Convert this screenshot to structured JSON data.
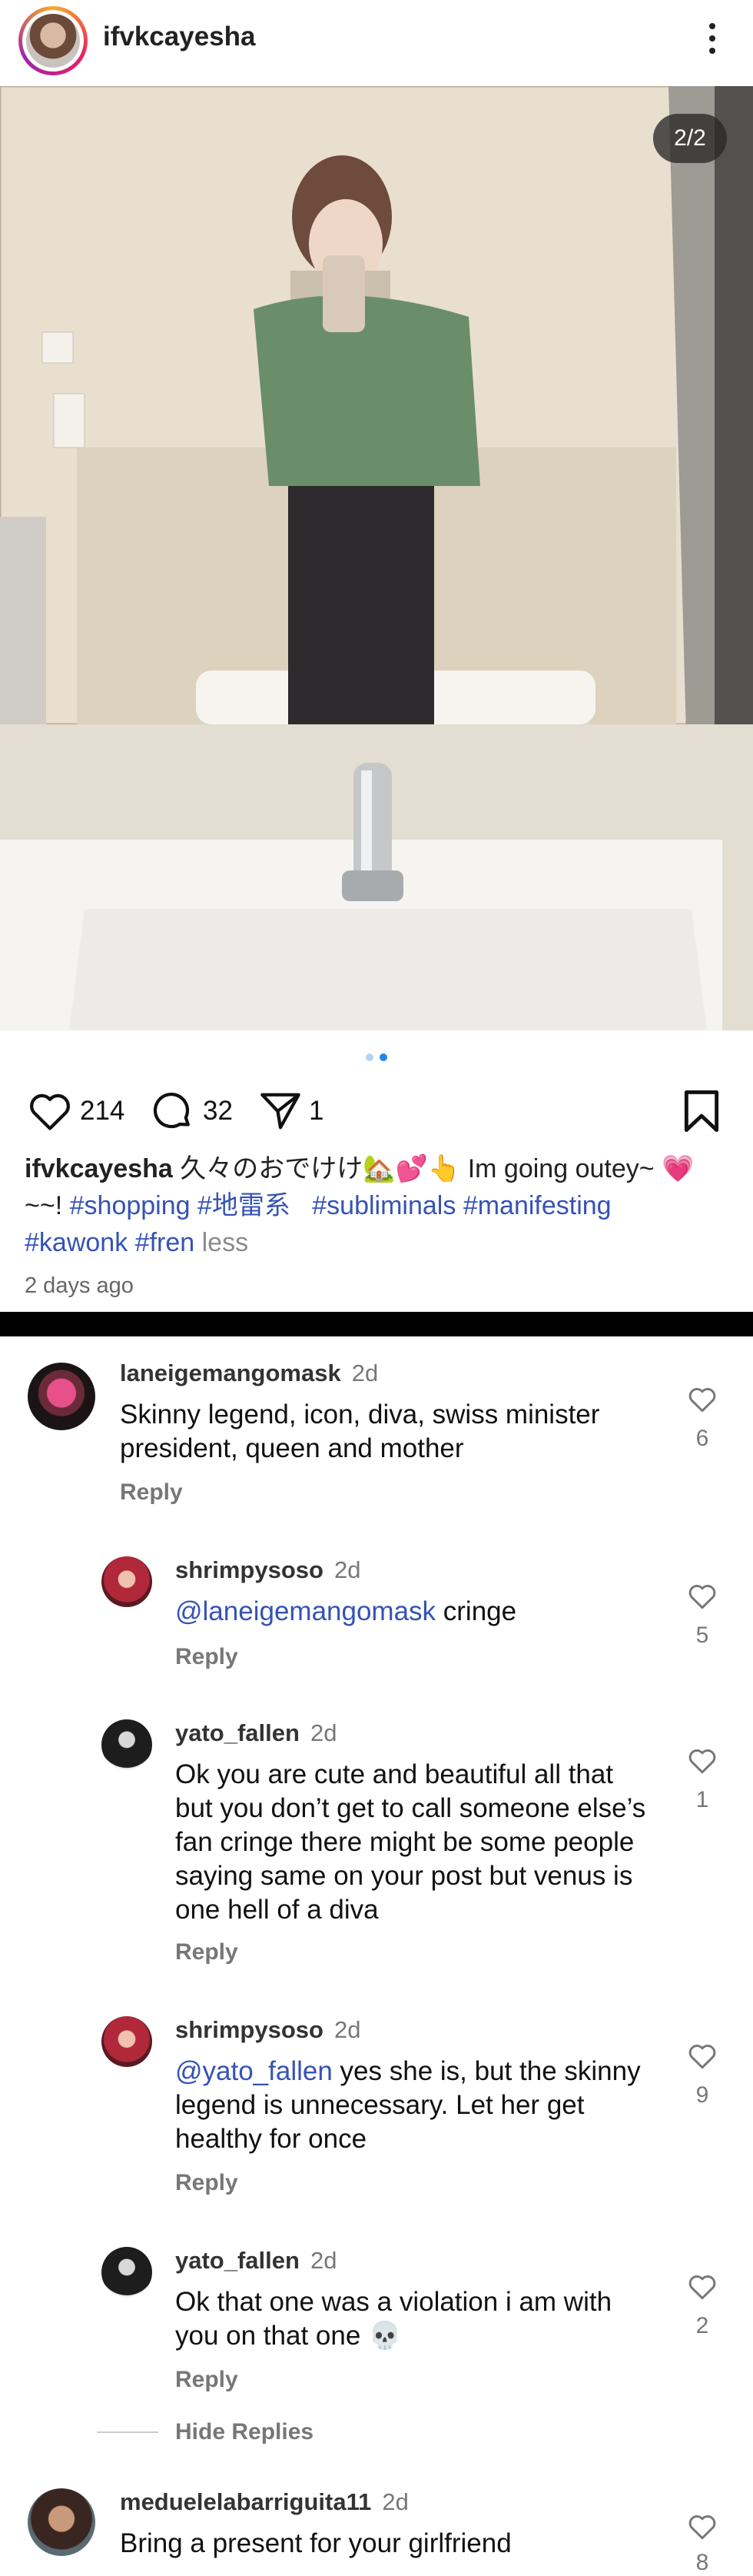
{
  "header": {
    "username": "ifvkcayesha",
    "more_icon": "kebab-menu-icon"
  },
  "post": {
    "image_counter": "2/2",
    "carousel_total": 2,
    "carousel_active": 2,
    "likes": "214",
    "comments": "32",
    "shares": "1",
    "caption_user": "ifvkcayesha",
    "caption_text": "久々のおでけけ🏡💕👆    Im going outey~ 💗~~!",
    "hashtags": [
      "#shopping",
      "#地雷系",
      "#subliminals",
      "#manifesting",
      "#kawonk",
      "#fren"
    ],
    "less_label": "less",
    "time_ago": "2 days ago"
  },
  "colors": {
    "link_blue": "#3553b5",
    "muted_gray": "#777777",
    "divider": "#000000",
    "dot_active": "#1e88e5",
    "dot_inactive": "#b3d4f0"
  },
  "comments": [
    {
      "user": "laneigemangomask",
      "time": "2d",
      "mention": "",
      "text": "Skinny legend, icon, diva, swiss minister president, queen and mother",
      "likes": "6",
      "reply": "Reply"
    },
    {
      "user": "shrimpysoso",
      "time": "2d",
      "mention": "@laneigemangomask",
      "text": " cringe",
      "likes": "5",
      "reply": "Reply"
    },
    {
      "user": "yato_fallen",
      "time": "2d",
      "mention": "",
      "text": "Ok you are cute and beautiful all that but you don’t get to call someone else’s fan cringe there might be some people saying same on your post but venus is one hell of a diva",
      "likes": "1",
      "reply": "Reply"
    },
    {
      "user": "shrimpysoso",
      "time": "2d",
      "mention": "@yato_fallen",
      "text": " yes she is, but the skinny legend is unnecessary. Let her get healthy for once",
      "likes": "9",
      "reply": "Reply"
    },
    {
      "user": "yato_fallen",
      "time": "2d",
      "mention": "",
      "text": "Ok that one was a violation i am with you on that one 💀",
      "likes": "2",
      "reply": "Reply"
    },
    {
      "user": "meduelelabarriguita11",
      "time": "2d",
      "mention": "",
      "text": "Bring a present for your girlfriend",
      "likes": "8",
      "reply": ""
    }
  ],
  "hide_replies": "Hide Replies"
}
